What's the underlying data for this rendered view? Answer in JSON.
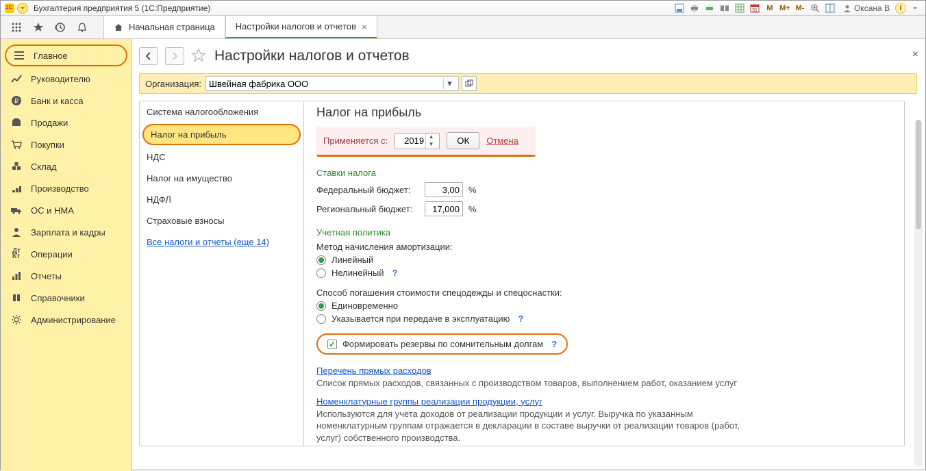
{
  "window": {
    "title": "Бухгалтерия предприятия 5  (1С:Предприятие)",
    "user": "Оксана В",
    "m_icons": [
      "M",
      "M+",
      "M-"
    ]
  },
  "tabs": {
    "home": "Начальная страница",
    "active": "Настройки налогов и отчетов"
  },
  "sidebar": {
    "items": [
      {
        "label": "Главное"
      },
      {
        "label": "Руководителю"
      },
      {
        "label": "Банк и касса"
      },
      {
        "label": "Продажи"
      },
      {
        "label": "Покупки"
      },
      {
        "label": "Склад"
      },
      {
        "label": "Производство"
      },
      {
        "label": "ОС и НМА"
      },
      {
        "label": "Зарплата и кадры"
      },
      {
        "label": "Операции"
      },
      {
        "label": "Отчеты"
      },
      {
        "label": "Справочники"
      },
      {
        "label": "Администрирование"
      }
    ]
  },
  "page": {
    "title": "Настройки налогов и отчетов",
    "org_label": "Организация:",
    "org_value": "Швейная фабрика ООО"
  },
  "taxnav": {
    "items": [
      "Система налогообложения",
      "Налог на прибыль",
      "НДС",
      "Налог на имущество",
      "НДФЛ",
      "Страховые взносы"
    ],
    "link": "Все налоги и отчеты (еще 14)"
  },
  "form": {
    "heading": "Налог на прибыль",
    "applies_label": "Применяется с:",
    "applies_value": "2019",
    "ok": "ОК",
    "cancel": "Отмена",
    "rates_title": "Ставки налога",
    "fed_label": "Федеральный бюджет:",
    "fed_value": "3,00",
    "reg_label": "Региональный бюджет:",
    "reg_value": "17,000",
    "pct": "%",
    "policy_title": "Учетная политика",
    "dep_method_label": "Метод начисления амортизации:",
    "dep_linear": "Линейный",
    "dep_nonlinear": "Нелинейный",
    "wear_label": "Способ погашения стоимости спецодежды и спецоснастки:",
    "wear_once": "Единовременно",
    "wear_on_issue": "Указывается при передаче в эксплуатацию",
    "reserve_label": "Формировать резервы по сомнительным долгам",
    "direct_link": "Перечень прямых расходов",
    "direct_desc": "Список прямых расходов, связанных с производством товаров, выполнением работ, оказанием услуг",
    "nomen_link": "Номенклатурные группы реализации продукции, услуг",
    "nomen_desc": "Используются для учета доходов от реализации продукции и услуг. Выручка по указанным номенклатурным группам отражается в декларации в составе выручки от реализации товаров (работ, услуг) собственного производства."
  }
}
